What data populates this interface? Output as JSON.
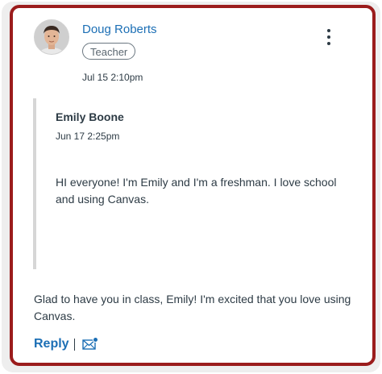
{
  "post": {
    "author": "Doug Roberts",
    "role": "Teacher",
    "timestamp": "Jul 15 2:10pm",
    "message": "Glad to have you in class, Emily! I'm excited that you love using Canvas.",
    "actions": {
      "reply_label": "Reply",
      "separator": "|"
    },
    "icons": {
      "menu": "kebab-menu-icon",
      "mail": "mail-icon",
      "avatar": "user-avatar"
    }
  },
  "quoted": {
    "author": "Emily Boone",
    "timestamp": "Jun 17 2:25pm",
    "message": "HI everyone! I'm Emily and I'm a freshman. I love school and using Canvas."
  },
  "colors": {
    "accent": "#1c6fb5",
    "border": "#9b1c1c",
    "text": "#2d3b45",
    "quote_bar": "#d6d6d6",
    "notify_dot": "#1c6fb5"
  }
}
